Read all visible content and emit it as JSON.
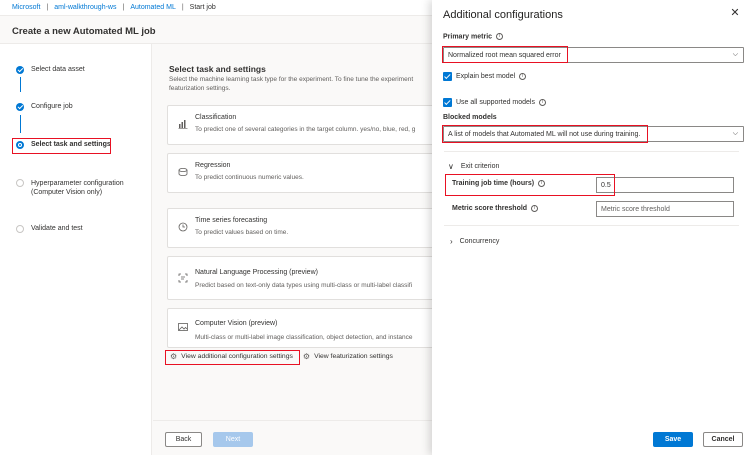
{
  "breadcrumb": [
    "Microsoft",
    "aml-walkthrough-ws",
    "Automated ML",
    "Start job"
  ],
  "page_title": "Create a new Automated ML job",
  "steps": [
    {
      "label": "Select data asset",
      "state": "done"
    },
    {
      "label": "Configure job",
      "state": "done"
    },
    {
      "label": "Select task and settings",
      "state": "current"
    },
    {
      "label": "Hyperparameter configuration",
      "label2": "(Computer Vision only)",
      "state": "todo"
    },
    {
      "label": "Validate and test",
      "state": "todo"
    }
  ],
  "main": {
    "heading": "Select task and settings",
    "intro_line1": "Select the machine learning task type for the experiment. To fine tune the experiment",
    "intro_line2": "featurization settings.",
    "cards": [
      {
        "title": "Classification",
        "desc": "To predict one of several categories in the target column. yes/no, blue, red, g",
        "icon": "bar-chart-icon"
      },
      {
        "title": "Regression",
        "desc": "To predict continuous numeric values.",
        "icon": "stack-icon"
      },
      {
        "title": "Time series forecasting",
        "desc": "To predict values based on time.",
        "icon": "clock-icon"
      },
      {
        "title": "Natural Language Processing (preview)",
        "desc": "Predict based on text-only data types using multi-class or multi-label classifi",
        "icon": "text-scan-icon"
      },
      {
        "title": "Computer Vision (preview)",
        "desc": "Multi-class or multi-label image classification, object detection, and instance",
        "icon": "image-icon"
      }
    ],
    "link_additional": "View additional configuration settings",
    "link_featurization": "View featurization settings",
    "back_label": "Back",
    "next_label": "Next"
  },
  "panel": {
    "title": "Additional configurations",
    "primary_metric_label": "Primary metric",
    "primary_metric_value": "Normalized root mean squared error",
    "explain_best_model": "Explain best model",
    "use_all_models": "Use all supported models",
    "blocked_models_label": "Blocked models",
    "blocked_models_placeholder": "A list of models that Automated ML will not use during training.",
    "exit_criterion": "Exit criterion",
    "training_time_label": "Training job time (hours)",
    "training_time_value": "0.5",
    "metric_threshold_label": "Metric score threshold",
    "metric_threshold_placeholder": "Metric score threshold",
    "concurrency": "Concurrency",
    "save_label": "Save",
    "cancel_label": "Cancel"
  },
  "colors": {
    "accent": "#0078d4",
    "highlight": "#e81123",
    "next_disabled": "#a6c8ec"
  }
}
